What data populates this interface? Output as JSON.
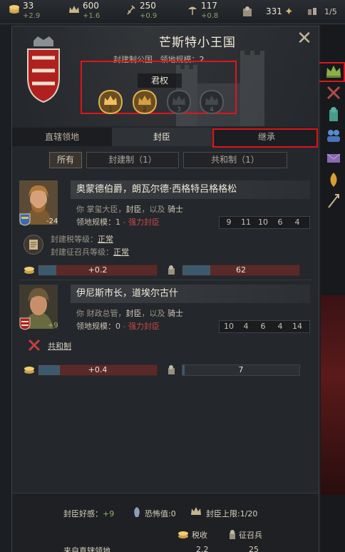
{
  "topbar": {
    "resources": [
      {
        "icon": "gold-icon",
        "value": "33",
        "delta": "+2.9"
      },
      {
        "icon": "prestige-icon",
        "value": "600",
        "delta": "+1.6"
      },
      {
        "icon": "piety-icon",
        "value": "250",
        "delta": "+0.9"
      },
      {
        "icon": "renown-icon",
        "value": "117",
        "delta": "+0.8"
      }
    ],
    "army": "331",
    "rank": "1/5"
  },
  "realm": {
    "title": "芒斯特小王国",
    "subtitle_label": "封建制公国",
    "size_label": "领地规模：",
    "size_value": "2",
    "authority_label": "君权",
    "authority_levels": [
      "1",
      "2",
      "3",
      "4"
    ],
    "authority_current": 2
  },
  "tabs": [
    "直辖领地",
    "封臣",
    "继承"
  ],
  "filters": {
    "all": "所有",
    "feudal": "封建制（1）",
    "republic": "共和制（1）"
  },
  "vassals": [
    {
      "name": "奥蒙德伯爵，朗瓦尔德·西格特吕格格松",
      "desc_prefix": "你 掌玺大臣，",
      "desc_vassal": "封臣",
      "desc_mid": "，以及",
      "desc_knight": "骑士",
      "size_label": "领地规模：",
      "size_value": "1",
      "size_note": "- 强力封臣",
      "opinion": "-24",
      "stats": [
        "9",
        "11",
        "10",
        "6",
        "4"
      ],
      "laws": [
        {
          "label": "封建税等级：",
          "value": "正常"
        },
        {
          "label": "封建征召兵等级：",
          "value": "正常"
        }
      ],
      "tax_value": "+0.2",
      "tax_fill": 0.15,
      "levy_value": "62",
      "levy_fill": 0.24
    },
    {
      "name": "伊尼斯市长，道埃尔古什",
      "desc_prefix": "你 财政总管，",
      "desc_vassal": "封臣",
      "desc_mid": "，以及",
      "desc_knight": "骑士",
      "size_label": "领地规模：",
      "size_value": "0",
      "size_note": "- 强力封臣",
      "opinion": "+9",
      "stats": [
        "10",
        "4",
        "6",
        "4",
        "14"
      ],
      "government_type": "共和制",
      "tax_value": "+0.4",
      "tax_fill": 0.18,
      "levy_value": "7",
      "levy_fill": 0.02
    }
  ],
  "summary": {
    "opinion_label": "封臣好感：",
    "opinion_value": "+9",
    "dread_label": "恐怖值:0",
    "vassal_limit": "封臣上限:1/20",
    "col_tax": "税收",
    "col_levy": "征召兵",
    "row_label": "来自直辖领地",
    "row_tax": "2.2",
    "row_levy": "25"
  },
  "colors": {
    "accent_red": "#e0141b",
    "panel": "#24272b",
    "strong_vassal": "#c24a4a",
    "positive": "#8fb46a"
  }
}
